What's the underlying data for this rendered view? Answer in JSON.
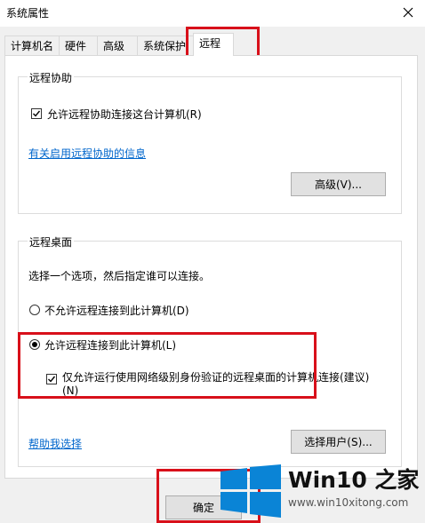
{
  "window": {
    "title": "系统属性"
  },
  "tabs": [
    {
      "label": "计算机名"
    },
    {
      "label": "硬件"
    },
    {
      "label": "高级"
    },
    {
      "label": "系统保护"
    },
    {
      "label": "远程"
    }
  ],
  "remote_assistance": {
    "group_title": "远程协助",
    "allow_checkbox": {
      "label": "允许远程协助连接这台计算机(R)",
      "checked": true
    },
    "info_link": "有关启用远程协助的信息",
    "advanced_button": "高级(V)..."
  },
  "remote_desktop": {
    "group_title": "远程桌面",
    "instruction": "选择一个选项，然后指定谁可以连接。",
    "option_deny": {
      "label": "不允许远程连接到此计算机(D)",
      "selected": false
    },
    "option_allow": {
      "label": "允许远程连接到此计算机(L)",
      "selected": true
    },
    "nla_checkbox": {
      "label_line1": "仅允许运行使用网络级别身份验证的远程桌面的计算机连接(建议)",
      "label_line2": "(N)",
      "checked": true
    },
    "help_link": "帮助我选择",
    "select_users_button": "选择用户(S)..."
  },
  "footer": {
    "ok_button": "确定"
  },
  "watermark": {
    "brand": "Win10 之家",
    "url": "www.win10xitong.com"
  },
  "colors": {
    "highlight": "#d8101a",
    "link": "#0066cc",
    "win_logo": "#0a84d6"
  }
}
